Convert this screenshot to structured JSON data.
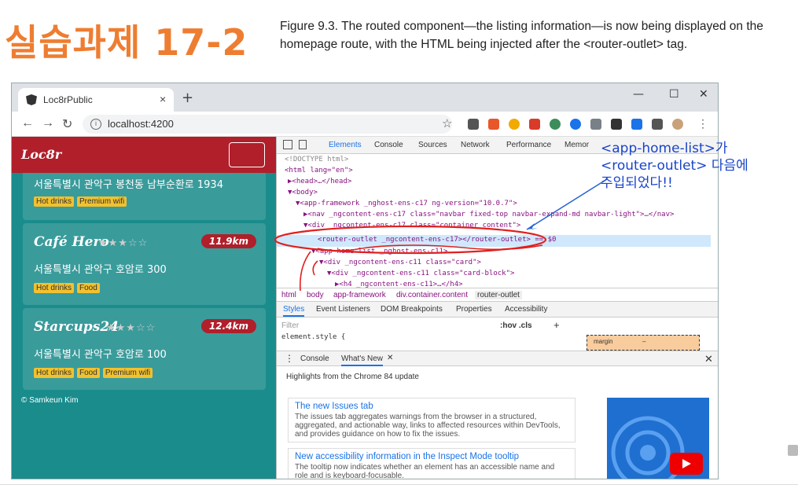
{
  "slide": {
    "title": "실습과제 17-2",
    "caption": "Figure 9.3. The routed component—the listing information—is now being displayed on the homepage route, with the HTML being injected after the <router-outlet> tag."
  },
  "browser": {
    "tab_title": "Loc8rPublic",
    "url": "localhost:4200",
    "tab_close": "×",
    "new_tab": "+"
  },
  "app": {
    "brand": "Loc8r",
    "first_card": {
      "address": "서울특별시 관악구 봉천동 남부순환로 1934",
      "tags": [
        "Hot drinks",
        "Premium wifi"
      ]
    },
    "cards": [
      {
        "name": "Café Hero",
        "rating": 3,
        "distance": "11.9km",
        "address": "서울특별시 관악구 호암로 300",
        "tags": [
          "Hot drinks",
          "Food"
        ]
      },
      {
        "name": "Starcups24",
        "rating": 3,
        "distance": "12.4km",
        "address": "서울특별시 관악구 호암로 100",
        "tags": [
          "Hot drinks",
          "Food",
          "Premium wifi"
        ]
      }
    ],
    "footer": "© Samkeun Kim"
  },
  "devtools": {
    "tabs": [
      "Elements",
      "Console",
      "Sources",
      "Network",
      "Performance",
      "Memor"
    ],
    "active_tab": "Elements",
    "lines": [
      "<!DOCTYPE html>",
      "<html lang=\"en\">",
      "▶<head>…</head>",
      "▼<body>",
      "▼<app-framework _nghost-ens-c17 ng-version=\"10.0.7\">",
      "▶<nav _ngcontent-ens-c17 class=\"navbar fixed-top navbar-expand-md navbar-light\">…</nav>",
      "▼<div _ngcontent-ens-c17 class=\"container content\">",
      "<router-outlet _ngcontent-ens-c17></router-outlet> == $0",
      "▼<app-home-list _nghost-ens-c11>",
      "▼<div _ngcontent-ens-c11 class=\"card\">",
      "▼<div _ngcontent-ens-c11 class=\"card-block\">",
      "▶<h4 _ngcontent-ens-c11>…</h4>"
    ],
    "breadcrumbs": [
      "html",
      "body",
      "app-framework",
      "div.container.content",
      "router-outlet"
    ],
    "styles_tabs": [
      "Styles",
      "Event Listeners",
      "DOM Breakpoints",
      "Properties",
      "Accessibility"
    ],
    "filter_placeholder": "Filter",
    "hov_cls": ":hov  .cls",
    "element_style": "element.style {",
    "box_model_label": "margin",
    "box_model_value": "–",
    "drawer_tabs": [
      "Console",
      "What's New"
    ],
    "highlights": "Highlights from the Chrome 84 update",
    "news": [
      {
        "title": "The new Issues tab",
        "body": "The issues tab aggregates warnings from the browser in a structured, aggregated, and actionable way, links to affected resources within DevTools, and provides guidance on how to fix the issues."
      },
      {
        "title": "New accessibility information in the Inspect Mode tooltip",
        "body": "The tooltip now indicates whether an element has an accessible name and role and is keyboard-focusable."
      }
    ]
  },
  "annotation": {
    "line1": "<app-home-list>가",
    "line2": "<router-outlet> 다음에",
    "line3": "주입되었다!!"
  },
  "colors": {
    "title_orange": "#ee7d31",
    "app_teal": "#1a8c8c",
    "navbar_red": "#b01f2a",
    "tag_yellow": "#f2c12e",
    "annotation_blue": "#1a44c9"
  }
}
